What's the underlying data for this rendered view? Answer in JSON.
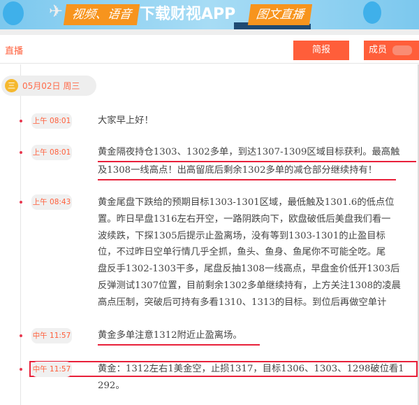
{
  "banner": {
    "left_tag": "视频、语音",
    "center": "下载财视APP",
    "right_tag": "图文直播"
  },
  "header": {
    "tab": "直播",
    "brief_button": "简报",
    "members_button": "成员"
  },
  "date": {
    "icon": "menu-icon",
    "glyph": "三",
    "label": "05月02日 周三"
  },
  "entries": [
    {
      "time": "上午 08:01",
      "lines": [
        "大家早上好！"
      ]
    },
    {
      "time": "上午 08:01",
      "lines": [
        "黄金隔夜持仓1303、1302多单，到达1307-1309区域目标获利。最高触",
        "及1308一线高点！出高留底后剩余1302多单的减仓部分继续持有！"
      ]
    },
    {
      "time": "上午 08:43",
      "lines": [
        "黄金尾盘下跌给的预期目标1303-1301区域，最低触及1301.6的低点位",
        "置。昨日早盘1316左右开空，一路阴跌向下，欧盘破低后美盘我们看一",
        "波续跌，下探1305后提示止盈离场，没有等到1303-1301的止盈目标",
        "位，不过昨日空单行情几乎全抓，鱼头、鱼身、鱼尾你不可能全吃。尾",
        "盘反手1302-1303干多，尾盘反抽1308一线高点，早盘金价低开1303后",
        "反弹测试1307位置，目前剩余1302多单继续持有，上方关注1308的凌晨",
        "高点压制，突破后可持有多看1310、1313的目标。到位后再做空单计"
      ]
    },
    {
      "time": "中午 11:57",
      "lines": [
        "黄金多单注意1312附近止盈离场。"
      ]
    },
    {
      "time": "中午 11:57",
      "lines": [
        "黄金：1312左右1美金空，止损1317，目标1306、1303、1298破位看1",
        "292。"
      ]
    }
  ]
}
